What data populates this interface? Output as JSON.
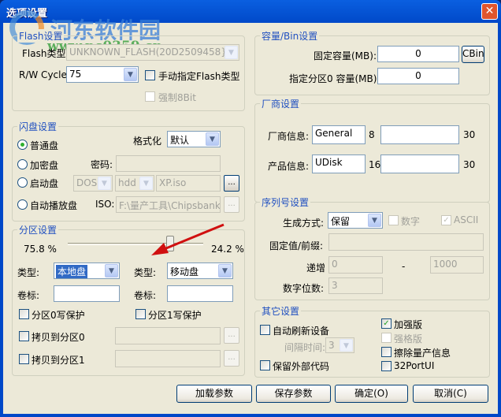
{
  "window": {
    "title": "选项设置",
    "close": "✕"
  },
  "watermark": {
    "name": "河东软件园",
    "url": "www.pc0359.cn"
  },
  "flash": {
    "title": "Flash设置",
    "type_label": "Flash类型:",
    "type_value": "UNKNOWN_FLASH(20D2509458}",
    "rw_label": "R/W Cycle:",
    "rw_value": "75",
    "manual_label": "手动指定Flash类型",
    "force8_label": "强制8Bit"
  },
  "disk": {
    "title": "闪盘设置",
    "radios": [
      "普通盘",
      "加密盘",
      "启动盘",
      "自动播放盘"
    ],
    "format_label": "格式化",
    "format_value": "默认",
    "password_label": "密码:",
    "boot_os": "DOS",
    "boot_dev": "hdd",
    "boot_iso": "XP.iso",
    "iso_label": "ISO:",
    "iso_value": "F:\\量产工具\\Chipsbank\\C",
    "browse": "..."
  },
  "partition": {
    "title": "分区设置",
    "left_pct": "75.8 %",
    "right_pct": "24.2 %",
    "slider_fraction": 0.758,
    "type_label": "类型:",
    "type0": "本地盘",
    "type1": "移动盘",
    "label_label": "卷标:",
    "wp0": "分区0写保护",
    "wp1": "分区1写保护",
    "copy0": "拷贝到分区0",
    "copy1": "拷贝到分区1"
  },
  "capacity": {
    "title": "容量/Bin设置",
    "fixed_label": "固定容量(MB):",
    "fixed_value": "0",
    "cbin": "CBin",
    "part0_label": "指定分区0 容量(MB):",
    "part0_value": "0"
  },
  "vendor": {
    "title": "厂商设置",
    "vendor_label": "厂商信息:",
    "vendor_value": "General",
    "vendor_len": "8",
    "vendor_max": "30",
    "product_label": "产品信息:",
    "product_value": "UDisk",
    "product_len": "16",
    "product_max": "30"
  },
  "serial": {
    "title": "序列号设置",
    "mode_label": "生成方式:",
    "mode_value": "保留",
    "digit_label": "数字",
    "ascii_label": "ASCII",
    "prefix_label": "固定值/前缀:",
    "inc_label": "递增",
    "inc_from": "0",
    "dash": "-",
    "inc_to": "1000",
    "digits_label": "数字位数:",
    "digits_value": "3"
  },
  "other": {
    "title": "其它设置",
    "auto_refresh": "自动刷新设备",
    "interval_label": "间隔时间:",
    "interval_value": "3",
    "keep_code": "保留外部代码",
    "enhanced": "加强版",
    "strict": "强格版",
    "erase": "擦除量产信息",
    "port32": "32PortUI"
  },
  "buttons": {
    "load": "加载参数",
    "save": "保存参数",
    "ok": "确定(O)",
    "cancel": "取消(C)"
  }
}
